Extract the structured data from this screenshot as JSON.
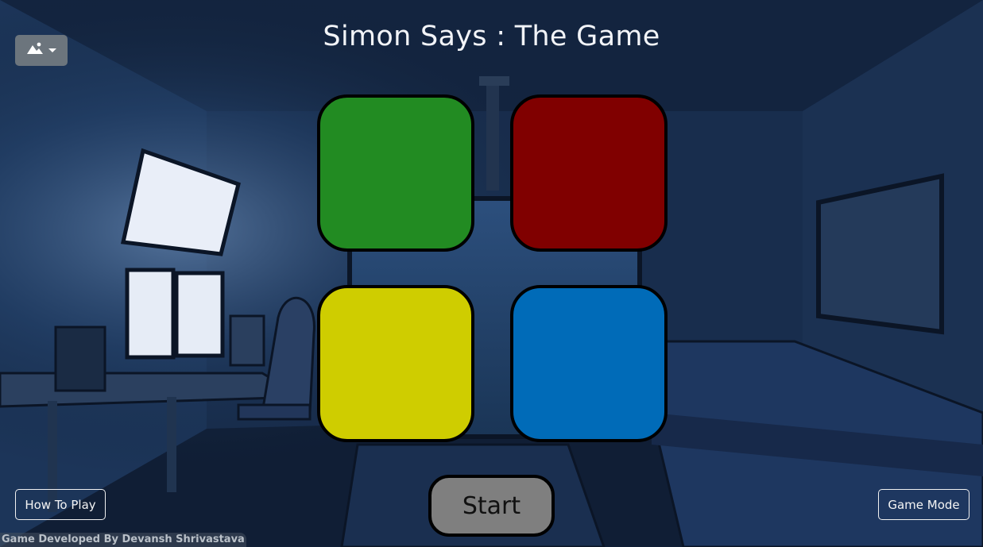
{
  "game": {
    "title": "Simon Says : The Game",
    "pads": [
      {
        "name": "green",
        "color": "#228b22"
      },
      {
        "name": "red",
        "color": "#800000"
      },
      {
        "name": "yellow",
        "color": "#cfcd00"
      },
      {
        "name": "blue",
        "color": "#006bb8"
      }
    ],
    "start_label": "Start"
  },
  "controls": {
    "background_toggle_icon": "image-icon",
    "background_toggle_caret": "chevron-down-icon",
    "how_to_play_label": "How To Play",
    "game_mode_label": "Game Mode"
  },
  "footer": {
    "credit": "Game Developed By Devansh Shrivastava"
  },
  "colors": {
    "scene_dark": "#0f1e33",
    "scene_mid": "#1f3a5f",
    "monitor_glow": "#e9eef8",
    "button_gray": "#6c757d",
    "start_gray": "#7f7f7f"
  }
}
